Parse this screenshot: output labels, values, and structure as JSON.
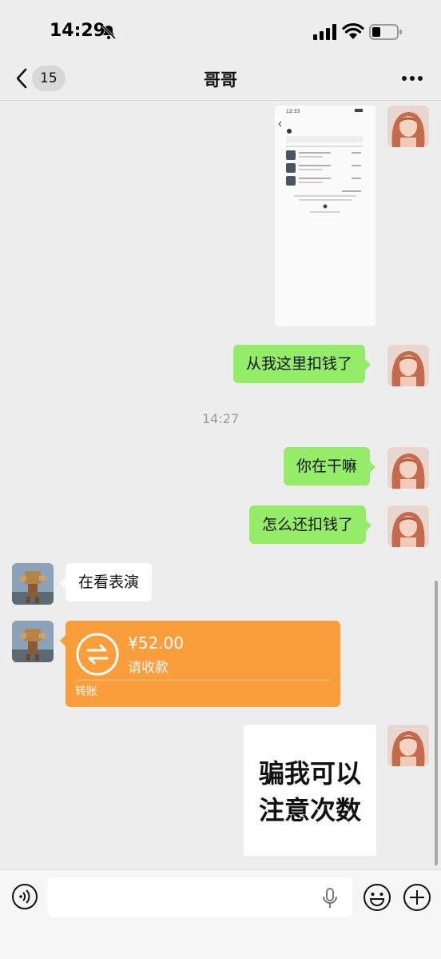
{
  "status_bar": {
    "time": "14:29"
  },
  "nav": {
    "unread_count": "15",
    "title": "哥哥"
  },
  "messages": [
    {
      "kind": "image",
      "sender": "me"
    },
    {
      "kind": "text",
      "sender": "me",
      "text": "从我这里扣钱了"
    },
    {
      "kind": "timestamp",
      "text": "14:27"
    },
    {
      "kind": "text",
      "sender": "me",
      "text": "你在干嘛"
    },
    {
      "kind": "text",
      "sender": "me",
      "text": "怎么还扣钱了"
    },
    {
      "kind": "text",
      "sender": "other",
      "text": "在看表演"
    },
    {
      "kind": "transfer",
      "sender": "other",
      "amount": "¥52.00",
      "status": "请收款",
      "label": "转账"
    },
    {
      "kind": "sticker",
      "sender": "me",
      "line1": "骗我可以",
      "line2": "注意次数"
    }
  ],
  "screenshot": {
    "time": "12:33"
  },
  "colors": {
    "my_bubble": "#95ec69",
    "their_bubble": "#ffffff",
    "transfer": "#fa9d3b",
    "background": "#ededed"
  }
}
